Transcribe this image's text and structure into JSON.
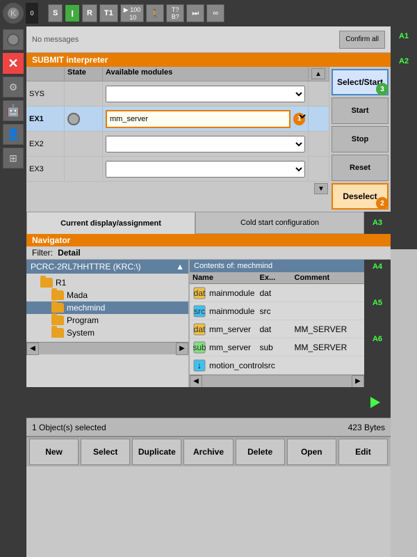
{
  "topbar": {
    "counter": "0",
    "s_label": "S",
    "i_label": "I",
    "r_label": "R",
    "t1_label": "T1",
    "speed": "100\n10",
    "walk_icon": "🚶",
    "t_b_label": "T?\nB?",
    "skip_icon": "⏭",
    "inf_icon": "∞"
  },
  "messages": {
    "text": "No messages",
    "confirm_all": "Confirm all"
  },
  "submit": {
    "title": "SUBMIT interpreter",
    "col_state": "State",
    "col_modules": "Available modules",
    "rows": [
      {
        "id": "SYS",
        "value": "",
        "selected": false,
        "has_state": false
      },
      {
        "id": "EX1",
        "value": "mm_server",
        "selected": true,
        "has_state": true
      },
      {
        "id": "EX2",
        "value": "",
        "selected": false,
        "has_state": false
      },
      {
        "id": "EX3",
        "value": "",
        "selected": false,
        "has_state": false
      }
    ],
    "buttons": {
      "select_start": "Select/Start",
      "start": "Start",
      "stop": "Stop",
      "reset": "Reset",
      "deselect": "Deselect"
    },
    "badges": {
      "select_start": "3",
      "deselect": "2"
    }
  },
  "tabs": {
    "current": "Current display/assignment",
    "cold_start": "Cold start configuration",
    "right_label": "A3"
  },
  "navigator": {
    "title": "Navigator",
    "filter_label": "Filter:",
    "filter_value": "Detail",
    "tree_header": "PCRC-2RL7HHTTRE (KRC:\\)",
    "contents_header": "Contents of: mechmind",
    "col_name": "Name",
    "col_ex": "Ex...",
    "col_comment": "Comment",
    "tree_items": [
      {
        "label": "R1",
        "level": 1,
        "type": "folder"
      },
      {
        "label": "Mada",
        "level": 2,
        "type": "folder"
      },
      {
        "label": "mechmind",
        "level": 2,
        "type": "folder",
        "selected": true
      },
      {
        "label": "Program",
        "level": 2,
        "type": "folder"
      },
      {
        "label": "System",
        "level": 2,
        "type": "folder"
      }
    ],
    "files": [
      {
        "name": "mainmodule",
        "ext": "dat",
        "comment": "",
        "icon": "src_dat"
      },
      {
        "name": "mainmodule",
        "ext": "src",
        "comment": "",
        "icon": "src_file"
      },
      {
        "name": "mm_server",
        "ext": "dat",
        "comment": "MM_SERVER",
        "icon": "src_dat",
        "selected": false
      },
      {
        "name": "mm_server",
        "ext": "sub",
        "comment": "MM_SERVER",
        "icon": "src_file"
      },
      {
        "name": "motion_control",
        "ext": "src",
        "comment": "",
        "icon": "arrow_file"
      }
    ],
    "sidebar_labels": [
      "A4",
      "A5",
      "A6"
    ]
  },
  "status_bar": {
    "objects": "1 Object(s) selected",
    "bytes": "423 Bytes"
  },
  "bottom_toolbar": {
    "new": "New",
    "select": "Select",
    "duplicate": "Duplicate",
    "archive": "Archive",
    "delete": "Delete",
    "open": "Open",
    "edit": "Edit"
  },
  "right_sidebar": {
    "labels": [
      "A1",
      "A2",
      "A3",
      "A4",
      "A5",
      "A6"
    ]
  }
}
